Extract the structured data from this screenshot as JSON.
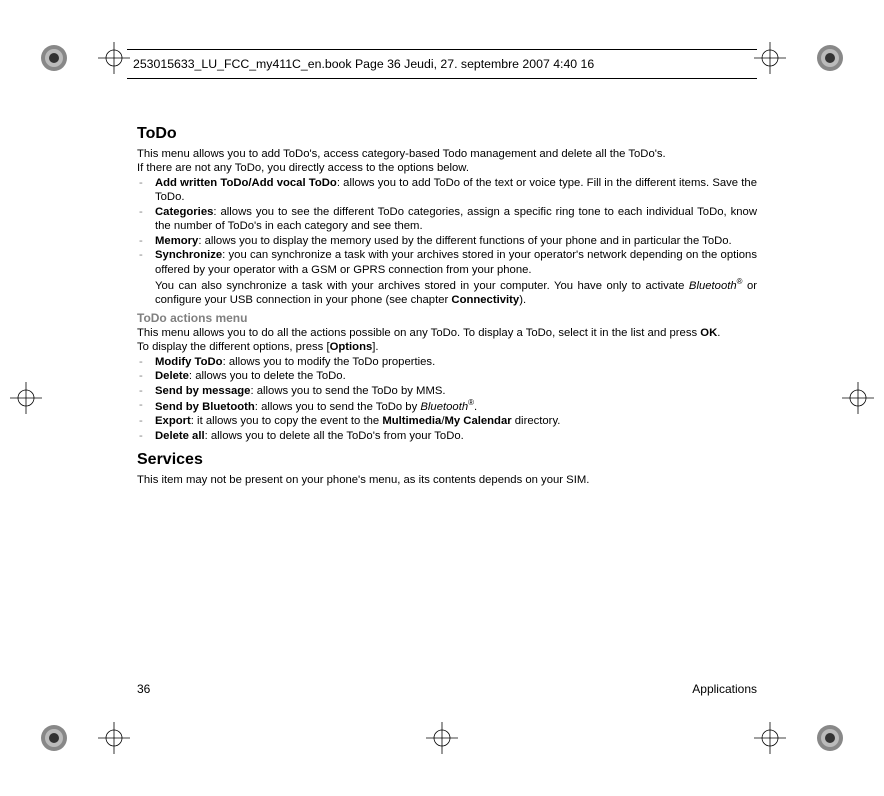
{
  "header_text": "253015633_LU_FCC_my411C_en.book  Page 36  Jeudi, 27. septembre 2007  4:40 16",
  "sections": {
    "todo": {
      "title": "ToDo",
      "intro1": "This menu allows you to add ToDo's, access category-based Todo management and delete all the ToDo's.",
      "intro2": "If there are not any ToDo, you directly access to the options below.",
      "bullets": {
        "b1": {
          "label": "Add written ToDo/Add vocal ToDo",
          "text": ": allows you to add ToDo of the text or voice type. Fill in the different items. Save the ToDo."
        },
        "b2": {
          "label": "Categories",
          "text": ": allows you to see the different ToDo categories, assign a specific ring tone to each individual ToDo, know the number of ToDo's in each category and see them."
        },
        "b3": {
          "label": "Memory",
          "text": ": allows you to display the memory used by the different functions of your phone and in particular the ToDo."
        },
        "b4": {
          "label": "Synchronize",
          "text1": ": you can synchronize a task with your archives stored in your operator's network depending on the options offered by your operator with a GSM or GPRS connection from your phone.",
          "text2a": "You can also synchronize a task with your archives stored in your computer. You have only to activate ",
          "bt": "Bluetooth",
          "text2b": " or configure your USB connection in your phone (see chapter ",
          "conn": "Connectivity",
          "text2c": ")."
        }
      },
      "actions": {
        "subtitle": "ToDo actions menu",
        "p1a": "This menu allows you to do all the actions possible on any ToDo. To display a ToDo, select it in the list and press ",
        "ok": "OK",
        "p1b": ".",
        "p2a": "To display the different options, press [",
        "opt": "Options",
        "p2b": "].",
        "bullets": {
          "a1": {
            "label": "Modify ToDo",
            "text": ": allows you to modify the ToDo properties."
          },
          "a2": {
            "label": "Delete",
            "text": ": allows you to delete the ToDo."
          },
          "a3": {
            "label": "Send by message",
            "text": ": allows you to send the ToDo by MMS."
          },
          "a4": {
            "label": "Send by Bluetooth",
            "text_a": ": allows you to send the ToDo by ",
            "bt": "Bluetooth",
            "text_b": "."
          },
          "a5": {
            "label": "Export",
            "text_a": ": it allows you to copy the event to the ",
            "mm": "Multimedia",
            "slash": "/",
            "mc": "My Calendar",
            "text_b": " directory."
          },
          "a6": {
            "label": "Delete all",
            "text": ": allows you to delete all the ToDo's from your ToDo."
          }
        }
      }
    },
    "services": {
      "title": "Services",
      "text": "This item may not be present on your phone's menu, as its contents depends on your SIM."
    }
  },
  "footer": {
    "page": "36",
    "section": "Applications"
  }
}
